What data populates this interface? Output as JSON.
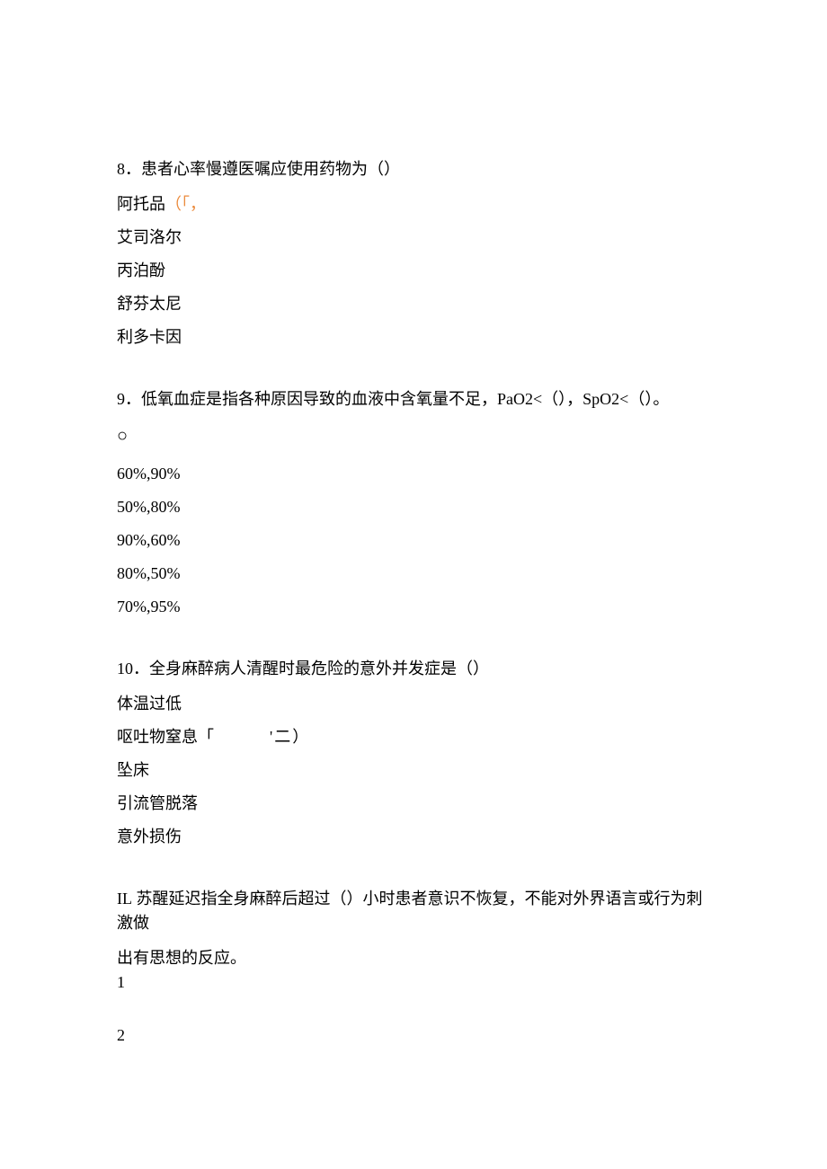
{
  "questions": [
    {
      "number": "8",
      "text": "．患者心率慢遵医嘱应使用药物为（）",
      "options": [
        {
          "text": "阿托品",
          "hint": "（「，"
        },
        {
          "text": "艾司洛尔"
        },
        {
          "text": "丙泊酚"
        },
        {
          "text": "舒芬太尼"
        },
        {
          "text": "利多卡因"
        }
      ]
    },
    {
      "number": "9",
      "text_pre": "．低氧血症是指各种原因导致的血液中含氧量不足，",
      "text_pao2": "PaO2<",
      "text_mid1": "（），",
      "text_spo2": "SpO2<",
      "text_mid2": "（）。",
      "circle": "○",
      "options": [
        {
          "text": "60%,90%"
        },
        {
          "text": "50%,80%"
        },
        {
          "text": "90%,60%"
        },
        {
          "text": "80%,50%"
        },
        {
          "text": "70%,95%"
        }
      ]
    },
    {
      "number": "10",
      "text": "．全身麻醉病人清醒时最危险的意外并发症是（）",
      "options": [
        {
          "text": "体温过低"
        },
        {
          "text": "呕吐物窒息",
          "hint": "「　　　'二）"
        },
        {
          "text": "坠床"
        },
        {
          "text": "引流管脱落"
        },
        {
          "text": "意外损伤"
        }
      ]
    },
    {
      "number": "IL",
      "text_line1": "苏醒延迟指全身麻醉后超过（）小时患者意识不恢复，不能对外界语言或行为刺激做",
      "text_line2": "出有思想的反应。",
      "options": [
        {
          "text": "1"
        },
        {
          "text": "2"
        }
      ]
    }
  ]
}
